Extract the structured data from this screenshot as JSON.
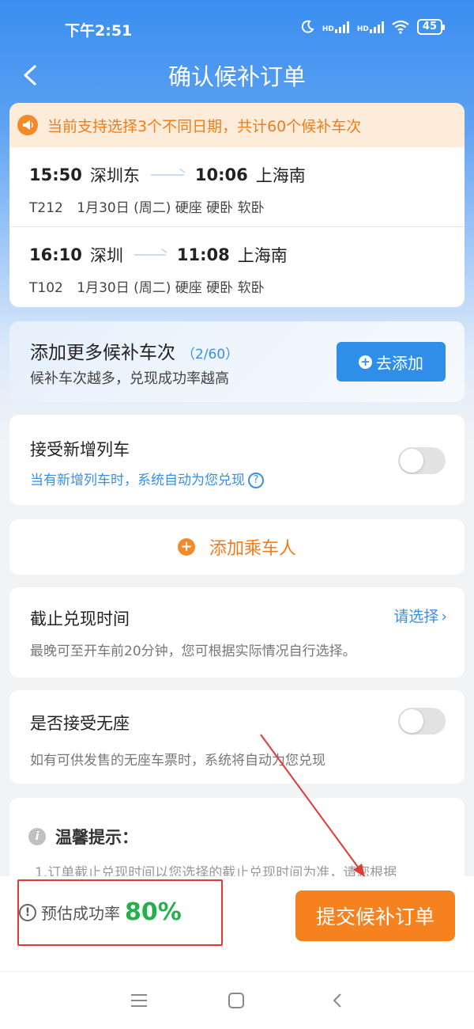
{
  "status": {
    "time": "下午2:51",
    "battery": "45",
    "hd": "HD"
  },
  "header": {
    "title": "确认候补订单"
  },
  "notice": {
    "text": "当前支持选择3个不同日期，共计60个候补车次"
  },
  "trains": [
    {
      "depart_time": "15:50",
      "depart_station": "深圳东",
      "arrive_time": "10:06",
      "arrive_station": "上海南",
      "train_no": "T212",
      "date": "1月30日 (周二)",
      "seats": "硬座 硬卧 软卧"
    },
    {
      "depart_time": "16:10",
      "depart_station": "深圳",
      "arrive_time": "11:08",
      "arrive_station": "上海南",
      "train_no": "T102",
      "date": "1月30日 (周二)",
      "seats": "硬座 硬卧 软卧"
    }
  ],
  "add_more": {
    "title": "添加更多候补车次",
    "count": "（2/60）",
    "subtitle": "候补车次越多，兑现成功率越高",
    "button": "去添加"
  },
  "new_trains": {
    "title": "接受新增列车",
    "subtitle": "当有新增列车时，系统自动为您兑现",
    "help": "?",
    "enabled": false
  },
  "passenger": {
    "label": "添加乘车人"
  },
  "deadline": {
    "title": "截止兑现时间",
    "link": "请选择",
    "subtitle": "最晚可至开车前20分钟，您可根据实际情况自行选择。"
  },
  "no_seat": {
    "title": "是否接受无座",
    "subtitle": "如有可供发售的无座车票时，系统将自动为您兑现",
    "enabled": false
  },
  "tips": {
    "title": "温馨提示：",
    "text": "1.订单截止兑现时间以您选择的截止兑现时间为准，请您根据"
  },
  "bottom": {
    "rate_label": "预估成功率",
    "rate_value": "80%",
    "submit": "提交候补订单"
  },
  "colors": {
    "primary": "#2f8ee8",
    "accent": "#f5821f",
    "success": "#24b04a",
    "annotation": "#e53935"
  }
}
